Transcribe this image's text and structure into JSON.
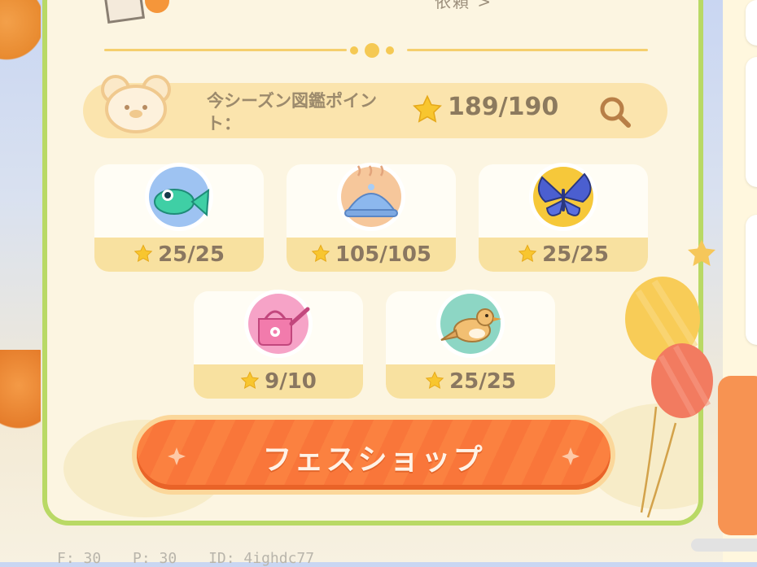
{
  "header": {
    "partial_text": "依頼 >"
  },
  "points_bar": {
    "label": "今シーズン図鑑ポイント：",
    "value": "189/190"
  },
  "categories": [
    {
      "icon": "fish-icon",
      "count": "25/25"
    },
    {
      "icon": "dish-cover-icon",
      "count": "105/105"
    },
    {
      "icon": "butterfly-icon",
      "count": "25/25"
    },
    {
      "icon": "watering-can-icon",
      "count": "9/10"
    },
    {
      "icon": "bird-icon",
      "count": "25/25"
    }
  ],
  "shop_button": {
    "label": "フェスショップ"
  },
  "footer": {
    "f": "F: 30",
    "p": "P: 30",
    "id": "ID: 4ighdc77"
  },
  "colors": {
    "panel_border": "#b9d965",
    "panel_bg": "#fcf5e1",
    "button_orange": "#fb8140",
    "points_bar_bg": "#fbe4ad",
    "card_base": "#f8e1a0"
  }
}
